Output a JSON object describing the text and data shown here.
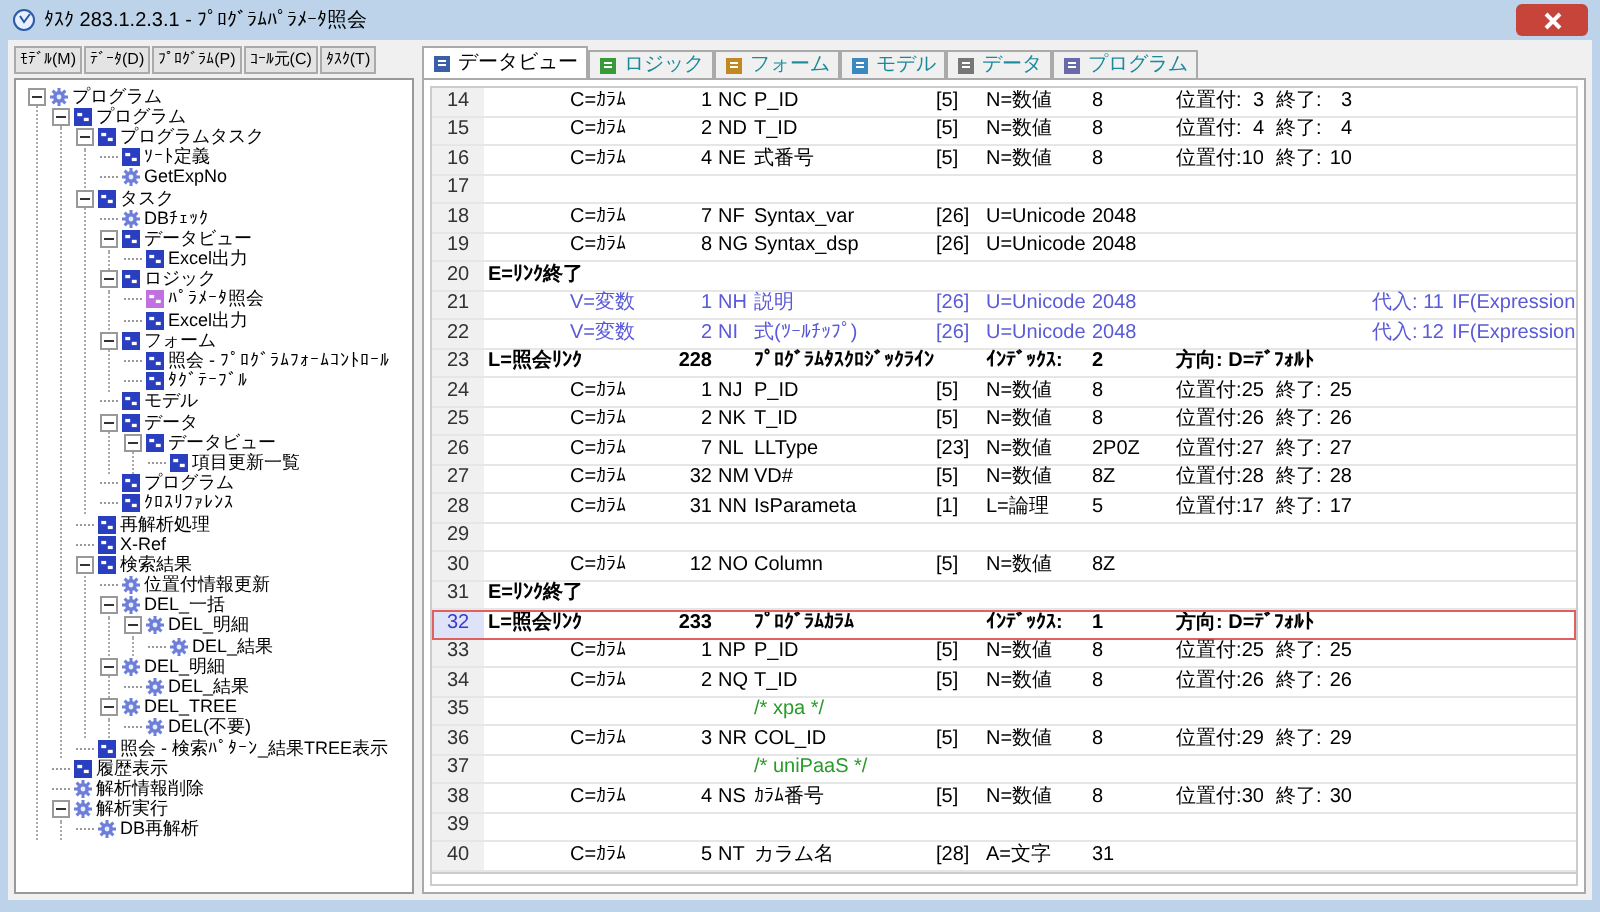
{
  "window": {
    "title": "ﾀｽｸ 283.1.2.3.1 - ﾌﾟﾛｸﾞﾗﾑﾊﾟﾗﾒｰﾀ照会"
  },
  "left_tabs": [
    {
      "label": "ﾓﾃﾞﾙ(M)",
      "selected": false
    },
    {
      "label": "ﾃﾞｰﾀ(D)",
      "selected": false
    },
    {
      "label": "ﾌﾟﾛｸﾞﾗﾑ(P)",
      "selected": false
    },
    {
      "label": "ｺｰﾙ元(C)",
      "selected": false
    },
    {
      "label": "ﾀｽｸ(T)",
      "selected": false
    }
  ],
  "tree": [
    {
      "label": "プログラム",
      "kind": "gear",
      "expanded": true,
      "children": [
        {
          "label": "プログラム",
          "kind": "task",
          "expanded": true,
          "children": [
            {
              "label": "プログラムタスク",
              "kind": "task",
              "expanded": true,
              "children": [
                {
                  "label": "ｿｰﾄ定義",
                  "kind": "task"
                },
                {
                  "label": "GetExpNo",
                  "kind": "gear"
                }
              ]
            },
            {
              "label": "タスク",
              "kind": "task",
              "expanded": true,
              "children": [
                {
                  "label": "DBﾁｪｯｸ",
                  "kind": "gear"
                },
                {
                  "label": "データビュー",
                  "kind": "task",
                  "expanded": true,
                  "children": [
                    {
                      "label": "Excel出力",
                      "kind": "task"
                    }
                  ]
                },
                {
                  "label": "ロジック",
                  "kind": "task",
                  "expanded": true,
                  "children": [
                    {
                      "label": "ﾊﾟﾗﾒｰﾀ照会",
                      "kind": "current"
                    },
                    {
                      "label": "Excel出力",
                      "kind": "task"
                    }
                  ]
                },
                {
                  "label": "フォーム",
                  "kind": "task",
                  "expanded": true,
                  "children": [
                    {
                      "label": "照会 - ﾌﾟﾛｸﾞﾗﾑﾌｫｰﾑｺﾝﾄﾛｰﾙ",
                      "kind": "task"
                    },
                    {
                      "label": "ﾀｸﾞﾃｰﾌﾞﾙ",
                      "kind": "task"
                    }
                  ]
                },
                {
                  "label": "モデル",
                  "kind": "task"
                },
                {
                  "label": "データ",
                  "kind": "task",
                  "expanded": true,
                  "children": [
                    {
                      "label": "データビュー",
                      "kind": "task",
                      "expanded": true,
                      "children": [
                        {
                          "label": "項目更新一覧",
                          "kind": "task"
                        }
                      ]
                    }
                  ]
                },
                {
                  "label": "プログラム",
                  "kind": "task"
                },
                {
                  "label": "ｸﾛｽﾘﾌｧﾚﾝｽ",
                  "kind": "task"
                }
              ]
            },
            {
              "label": "再解析処理",
              "kind": "task"
            },
            {
              "label": "X-Ref",
              "kind": "task"
            },
            {
              "label": "検索結果",
              "kind": "task",
              "expanded": true,
              "children": [
                {
                  "label": "位置付情報更新",
                  "kind": "gear"
                },
                {
                  "label": "DEL_一括",
                  "kind": "gear",
                  "expanded": true,
                  "children": [
                    {
                      "label": "DEL_明細",
                      "kind": "gear",
                      "expanded": true,
                      "children": [
                        {
                          "label": "DEL_結果",
                          "kind": "gear"
                        }
                      ]
                    }
                  ]
                },
                {
                  "label": "DEL_明細",
                  "kind": "gear",
                  "expanded": true,
                  "children": [
                    {
                      "label": "DEL_結果",
                      "kind": "gear"
                    }
                  ]
                },
                {
                  "label": "DEL_TREE",
                  "kind": "gear",
                  "expanded": true,
                  "children": [
                    {
                      "label": "DEL(不要)",
                      "kind": "gear"
                    }
                  ]
                }
              ]
            },
            {
              "label": "照会 - 検索ﾊﾟﾀｰﾝ_結果TREE表示",
              "kind": "task"
            }
          ]
        },
        {
          "label": "履歴表示",
          "kind": "task"
        },
        {
          "label": "解析情報削除",
          "kind": "gear"
        },
        {
          "label": "解析実行",
          "kind": "gear",
          "expanded": true,
          "children": [
            {
              "label": "DB再解析",
              "kind": "gear"
            }
          ]
        }
      ]
    }
  ],
  "tabs": [
    {
      "label": "データビュー",
      "selected": true
    },
    {
      "label": "ロジック",
      "selected": false
    },
    {
      "label": "フォーム",
      "selected": false
    },
    {
      "label": "モデル",
      "selected": false
    },
    {
      "label": "データ",
      "selected": false
    },
    {
      "label": "プログラム",
      "selected": false
    }
  ],
  "rows": [
    {
      "line": "14",
      "kind": "column",
      "selected": false,
      "type": "C=ｶﾗﾑ",
      "index": "1",
      "code": "NC",
      "name": "P_ID",
      "size": "[5]",
      "attr": "N=数値",
      "picture": "8",
      "start_label": "位置付:",
      "start": "3",
      "end_label": "終了:",
      "end": "3"
    },
    {
      "line": "15",
      "kind": "column",
      "selected": false,
      "type": "C=ｶﾗﾑ",
      "index": "2",
      "code": "ND",
      "name": "T_ID",
      "size": "[5]",
      "attr": "N=数値",
      "picture": "8",
      "start_label": "位置付:",
      "start": "4",
      "end_label": "終了:",
      "end": "4"
    },
    {
      "line": "16",
      "kind": "column",
      "selected": false,
      "type": "C=ｶﾗﾑ",
      "index": "4",
      "code": "NE",
      "name": "式番号",
      "size": "[5]",
      "attr": "N=数値",
      "picture": "8",
      "start_label": "位置付:",
      "start": "10",
      "end_label": "終了:",
      "end": "10"
    },
    {
      "line": "17",
      "kind": "empty",
      "selected": false
    },
    {
      "line": "18",
      "kind": "column",
      "selected": false,
      "type": "C=ｶﾗﾑ",
      "index": "7",
      "code": "NF",
      "name": "Syntax_var",
      "size": "[26]",
      "attr": "U=Unicode",
      "picture": "2048"
    },
    {
      "line": "19",
      "kind": "column",
      "selected": false,
      "type": "C=ｶﾗﾑ",
      "index": "8",
      "code": "NG",
      "name": "Syntax_dsp",
      "size": "[26]",
      "attr": "U=Unicode",
      "picture": "2048"
    },
    {
      "line": "20",
      "kind": "end",
      "selected": false,
      "type": "E=ﾘﾝｸ終了"
    },
    {
      "line": "21",
      "kind": "variable",
      "selected": false,
      "type": "V=変数",
      "index": "1",
      "code": "NH",
      "name": "説明",
      "size": "[26]",
      "attr": "U=Unicode",
      "picture": "2048",
      "assign_label": "代入:",
      "assign_index": "11",
      "assign": "IF(Expression"
    },
    {
      "line": "22",
      "kind": "variable",
      "selected": false,
      "type": "V=変数",
      "index": "2",
      "code": "NI",
      "name": "式(ﾂｰﾙﾁｯﾌﾟ)",
      "size": "[26]",
      "attr": "U=Unicode",
      "picture": "2048",
      "assign_label": "代入:",
      "assign_index": "12",
      "assign": "IF(Expression"
    },
    {
      "line": "23",
      "kind": "link",
      "selected": false,
      "type": "L=照会ﾘﾝｸ",
      "index": "228",
      "name": "ﾌﾟﾛｸﾞﾗﾑﾀｽｸﾛｼﾞｯｸﾗｲﾝ",
      "attr": "ｲﾝﾃﾞｯｸｽ:",
      "picture": "2",
      "direction": "方向: D=ﾃﾞﾌｫﾙﾄ"
    },
    {
      "line": "24",
      "kind": "column",
      "selected": false,
      "type": "C=ｶﾗﾑ",
      "index": "1",
      "code": "NJ",
      "name": "P_ID",
      "size": "[5]",
      "attr": "N=数値",
      "picture": "8",
      "start_label": "位置付:",
      "start": "25",
      "end_label": "終了:",
      "end": "25"
    },
    {
      "line": "25",
      "kind": "column",
      "selected": false,
      "type": "C=ｶﾗﾑ",
      "index": "2",
      "code": "NK",
      "name": "T_ID",
      "size": "[5]",
      "attr": "N=数値",
      "picture": "8",
      "start_label": "位置付:",
      "start": "26",
      "end_label": "終了:",
      "end": "26"
    },
    {
      "line": "26",
      "kind": "column",
      "selected": false,
      "type": "C=ｶﾗﾑ",
      "index": "7",
      "code": "NL",
      "name": "LLType",
      "size": "[23]",
      "attr": "N=数値",
      "picture": "2P0Z",
      "start_label": "位置付:",
      "start": "27",
      "end_label": "終了:",
      "end": "27"
    },
    {
      "line": "27",
      "kind": "column",
      "selected": false,
      "type": "C=ｶﾗﾑ",
      "index": "32",
      "code": "NM",
      "name": "VD#",
      "size": "[5]",
      "attr": "N=数値",
      "picture": "8Z",
      "start_label": "位置付:",
      "start": "28",
      "end_label": "終了:",
      "end": "28"
    },
    {
      "line": "28",
      "kind": "column",
      "selected": false,
      "type": "C=ｶﾗﾑ",
      "index": "31",
      "code": "NN",
      "name": "IsParameta",
      "size": "[1]",
      "attr": "L=論理",
      "picture": "5",
      "start_label": "位置付:",
      "start": "17",
      "end_label": "終了:",
      "end": "17"
    },
    {
      "line": "29",
      "kind": "empty",
      "selected": false
    },
    {
      "line": "30",
      "kind": "column",
      "selected": false,
      "type": "C=ｶﾗﾑ",
      "index": "12",
      "code": "NO",
      "name": "Column",
      "size": "[5]",
      "attr": "N=数値",
      "picture": "8Z"
    },
    {
      "line": "31",
      "kind": "end",
      "selected": false,
      "type": "E=ﾘﾝｸ終了"
    },
    {
      "line": "32",
      "kind": "link",
      "selected": true,
      "type": "L=照会ﾘﾝｸ",
      "index": "233",
      "name": "ﾌﾟﾛｸﾞﾗﾑｶﾗﾑ",
      "attr": "ｲﾝﾃﾞｯｸｽ:",
      "picture": "1",
      "direction": "方向: D=ﾃﾞﾌｫﾙﾄ"
    },
    {
      "line": "33",
      "kind": "column",
      "selected": false,
      "type": "C=ｶﾗﾑ",
      "index": "1",
      "code": "NP",
      "name": "P_ID",
      "size": "[5]",
      "attr": "N=数値",
      "picture": "8",
      "start_label": "位置付:",
      "start": "25",
      "end_label": "終了:",
      "end": "25"
    },
    {
      "line": "34",
      "kind": "column",
      "selected": false,
      "type": "C=ｶﾗﾑ",
      "index": "2",
      "code": "NQ",
      "name": "T_ID",
      "size": "[5]",
      "attr": "N=数値",
      "picture": "8",
      "start_label": "位置付:",
      "start": "26",
      "end_label": "終了:",
      "end": "26"
    },
    {
      "line": "35",
      "kind": "comment",
      "selected": false,
      "name": "/* xpa */"
    },
    {
      "line": "36",
      "kind": "column",
      "selected": false,
      "type": "C=ｶﾗﾑ",
      "index": "3",
      "code": "NR",
      "name": "COL_ID",
      "size": "[5]",
      "attr": "N=数値",
      "picture": "8",
      "start_label": "位置付:",
      "start": "29",
      "end_label": "終了:",
      "end": "29"
    },
    {
      "line": "37",
      "kind": "comment",
      "selected": false,
      "name": "/* uniPaaS */"
    },
    {
      "line": "38",
      "kind": "column",
      "selected": false,
      "type": "C=ｶﾗﾑ",
      "index": "4",
      "code": "NS",
      "name": "ｶﾗﾑ番号",
      "size": "[5]",
      "attr": "N=数値",
      "picture": "8",
      "start_label": "位置付:",
      "start": "30",
      "end_label": "終了:",
      "end": "30"
    },
    {
      "line": "39",
      "kind": "empty",
      "selected": false
    },
    {
      "line": "40",
      "kind": "column",
      "selected": false,
      "type": "C=ｶﾗﾑ",
      "index": "5",
      "code": "NT",
      "name": "カラム名",
      "size": "[28]",
      "attr": "A=文字",
      "picture": "31"
    }
  ]
}
